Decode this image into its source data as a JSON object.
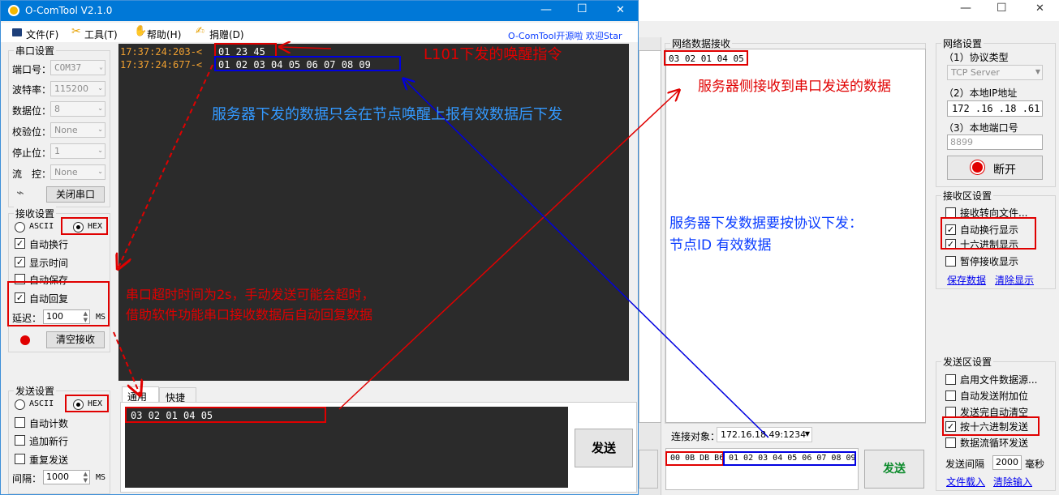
{
  "left": {
    "title": "O-ComTool V2.1.0",
    "window_controls": {
      "min": "—",
      "max": "☐",
      "close": "✕"
    },
    "menu": [
      {
        "label": "文件(F)",
        "icon": "folder-icon"
      },
      {
        "label": "工具(T)",
        "icon": "tools-icon"
      },
      {
        "label": "帮助(H)",
        "icon": "help-icon"
      },
      {
        "label": "捐赠(D)",
        "icon": "donate-icon"
      }
    ],
    "promo": "O-ComTool开源啦 欢迎Star",
    "serial": {
      "title": "串口设置",
      "port_label": "端口号：",
      "port_value": "COM37",
      "baud_label": "波特率：",
      "baud_value": "115200",
      "data_label": "数据位：",
      "data_value": "8",
      "parity_label": "校验位：",
      "parity_value": "None",
      "stop_label": "停止位：",
      "stop_value": "1",
      "flow_label": "流　控：",
      "flow_value": "None",
      "close_button": "关闭串口"
    },
    "recv": {
      "title": "接收设置",
      "ascii": "ASCII",
      "hex": "HEX",
      "auto_wrap": "自动换行",
      "show_time": "显示时间",
      "auto_save": "自动保存",
      "auto_reply": "自动回复",
      "delay_label": "延迟：",
      "delay_value": "100",
      "delay_unit": "MS",
      "clear_button": "清空接收"
    },
    "send": {
      "title": "发送设置",
      "ascii": "ASCII",
      "hex": "HEX",
      "auto_count": "自动计数",
      "add_newline": "追加新行",
      "repeat": "重复发送",
      "interval_label": "间隔：",
      "interval_value": "1000",
      "interval_unit": "MS"
    },
    "console": [
      {
        "time": "17:37:24:203-<",
        "data": "01 23 45"
      },
      {
        "time": "17:37:24:677-<",
        "data": "01 02 03 04 05 06 07 08 09"
      }
    ],
    "tabs": [
      "通用",
      "快捷"
    ],
    "send_input": "03 02 01 04 05",
    "send_button": "发送"
  },
  "right": {
    "window_controls": {
      "min": "—",
      "max": "☐",
      "close": "✕"
    },
    "recv_title": "网络数据接收",
    "recv_data": "03 02 01 04 05",
    "net": {
      "title": "网络设置",
      "proto_label": "（1）协议类型",
      "proto_value": "TCP Server",
      "ip_label": "（2）本地IP地址",
      "ip_value": "172 .16 .18 .61",
      "port_label": "（3）本地端口号",
      "port_value": "8899",
      "disconnect_button": "断开"
    },
    "recv_settings": {
      "title": "接收区设置",
      "to_file": "接收转向文件...",
      "auto_wrap": "自动换行显示",
      "hex_show": "十六进制显示",
      "pause": "暂停接收显示",
      "save_link": "保存数据",
      "clear_link": "清除显示"
    },
    "send_settings": {
      "title": "发送区设置",
      "file_source": "启用文件数据源...",
      "auto_append": "自动发送附加位",
      "clear_after": "发送完自动清空",
      "hex_send": "按十六进制发送",
      "loop": "数据流循环发送",
      "interval_label": "发送间隔",
      "interval_value": "2000",
      "interval_unit": "毫秒",
      "file_load": "文件载入",
      "clear_input": "清除输入"
    },
    "target_label": "连接对象：",
    "target_value": "172.16.18.49:1234",
    "send_prefix": "00 0B DB B6",
    "send_payload": "01 02 03 04 05 06 07 08 09",
    "send_button": "发送"
  },
  "annotations": {
    "wake_cmd": "L101下发的唤醒指令",
    "server_send_note": "服务器下发的数据只会在节点唤醒上报有效数据后下发",
    "server_recv_note": "服务器侧接收到串口发送的数据",
    "protocol_note_1": "服务器下发数据要按协议下发：",
    "protocol_note_2": "节点ID 有效数据",
    "timeout_note_1": "串口超时时间为2s，手动发送可能会超时，",
    "timeout_note_2": "借助软件功能串口接收数据后自动回复数据"
  },
  "colors": {
    "accent_red": "#e00000",
    "accent_blue": "#0000e0",
    "console_bg": "#2b2b2b",
    "console_time": "#f0a030",
    "send_green": "#0a8a2a"
  }
}
